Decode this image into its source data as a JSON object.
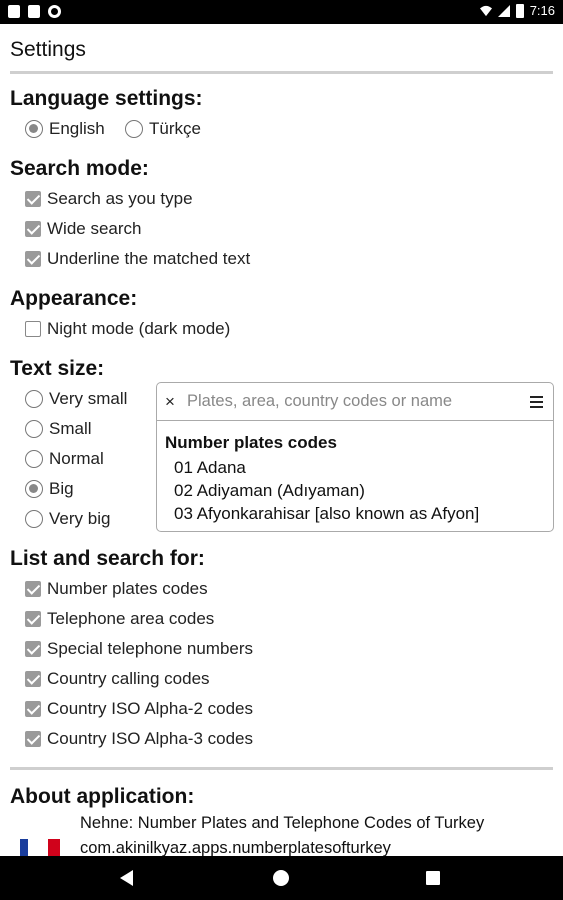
{
  "status_bar": {
    "time": "7:16",
    "left_icons": [
      "notification-a-icon",
      "sd-card-icon",
      "sync-circle-icon"
    ],
    "right_icons": [
      "wifi-icon",
      "signal-icon",
      "battery-icon"
    ]
  },
  "page": {
    "title": "Settings"
  },
  "language": {
    "title": "Language settings:",
    "options": [
      {
        "label": "English",
        "selected": true
      },
      {
        "label": "Türkçe",
        "selected": false
      }
    ]
  },
  "search_mode": {
    "title": "Search mode:",
    "options": [
      {
        "label": "Search as you type",
        "checked": true
      },
      {
        "label": "Wide search",
        "checked": true
      },
      {
        "label": "Underline the matched text",
        "checked": true
      }
    ]
  },
  "appearance": {
    "title": "Appearance:",
    "options": [
      {
        "label": "Night mode (dark mode)",
        "checked": false
      }
    ]
  },
  "text_size": {
    "title": "Text size:",
    "options": [
      {
        "label": "Very small",
        "selected": false
      },
      {
        "label": "Small",
        "selected": false
      },
      {
        "label": "Normal",
        "selected": false
      },
      {
        "label": "Big",
        "selected": true
      },
      {
        "label": "Very big",
        "selected": false
      }
    ]
  },
  "preview": {
    "close_symbol": "×",
    "search_placeholder": "Plates, area, country codes or name",
    "heading": "Number plates codes",
    "items": [
      "01 Adana",
      "02 Adiyaman (Adıyaman)",
      "03 Afyonkarahisar [also known as Afyon]"
    ]
  },
  "list_search": {
    "title": "List and search for:",
    "options": [
      {
        "label": "Number plates codes",
        "checked": true
      },
      {
        "label": "Telephone area codes",
        "checked": true
      },
      {
        "label": "Special telephone numbers",
        "checked": true
      },
      {
        "label": "Country calling codes",
        "checked": true
      },
      {
        "label": "Country ISO Alpha-2 codes",
        "checked": true
      },
      {
        "label": "Country ISO Alpha-3 codes",
        "checked": true
      }
    ]
  },
  "about": {
    "title": "About application:",
    "app_name": "Nehne: Number Plates and Telephone Codes of Turkey",
    "package": "com.akinilkyaz.apps.numberplatesofturkey"
  },
  "colors": {
    "checked": "#9a9a9a",
    "bars": "#000000",
    "flag_blue": "#1a3d9c",
    "flag_red": "#d0021b"
  }
}
